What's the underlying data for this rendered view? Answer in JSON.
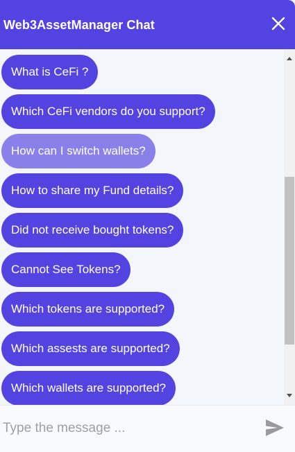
{
  "header": {
    "title": "Web3AssetManager Chat",
    "close_icon": "close-icon"
  },
  "quick_replies": [
    {
      "label": "What is CeFi ?"
    },
    {
      "label": "Which CeFi vendors do you support?"
    },
    {
      "label": "How can I switch wallets?"
    },
    {
      "label": "How to share my Fund details?"
    },
    {
      "label": "Did not receive bought tokens?"
    },
    {
      "label": "Cannot See Tokens?"
    },
    {
      "label": "Which tokens are supported?"
    },
    {
      "label": "Which assests are supported?"
    },
    {
      "label": "Which wallets are supported?"
    }
  ],
  "composer": {
    "placeholder": "Type the message ...",
    "value": "",
    "send_icon": "send-icon"
  },
  "colors": {
    "accent": "#5344e2",
    "accent_hover": "#8a80ea",
    "background": "#f3f6fb"
  }
}
